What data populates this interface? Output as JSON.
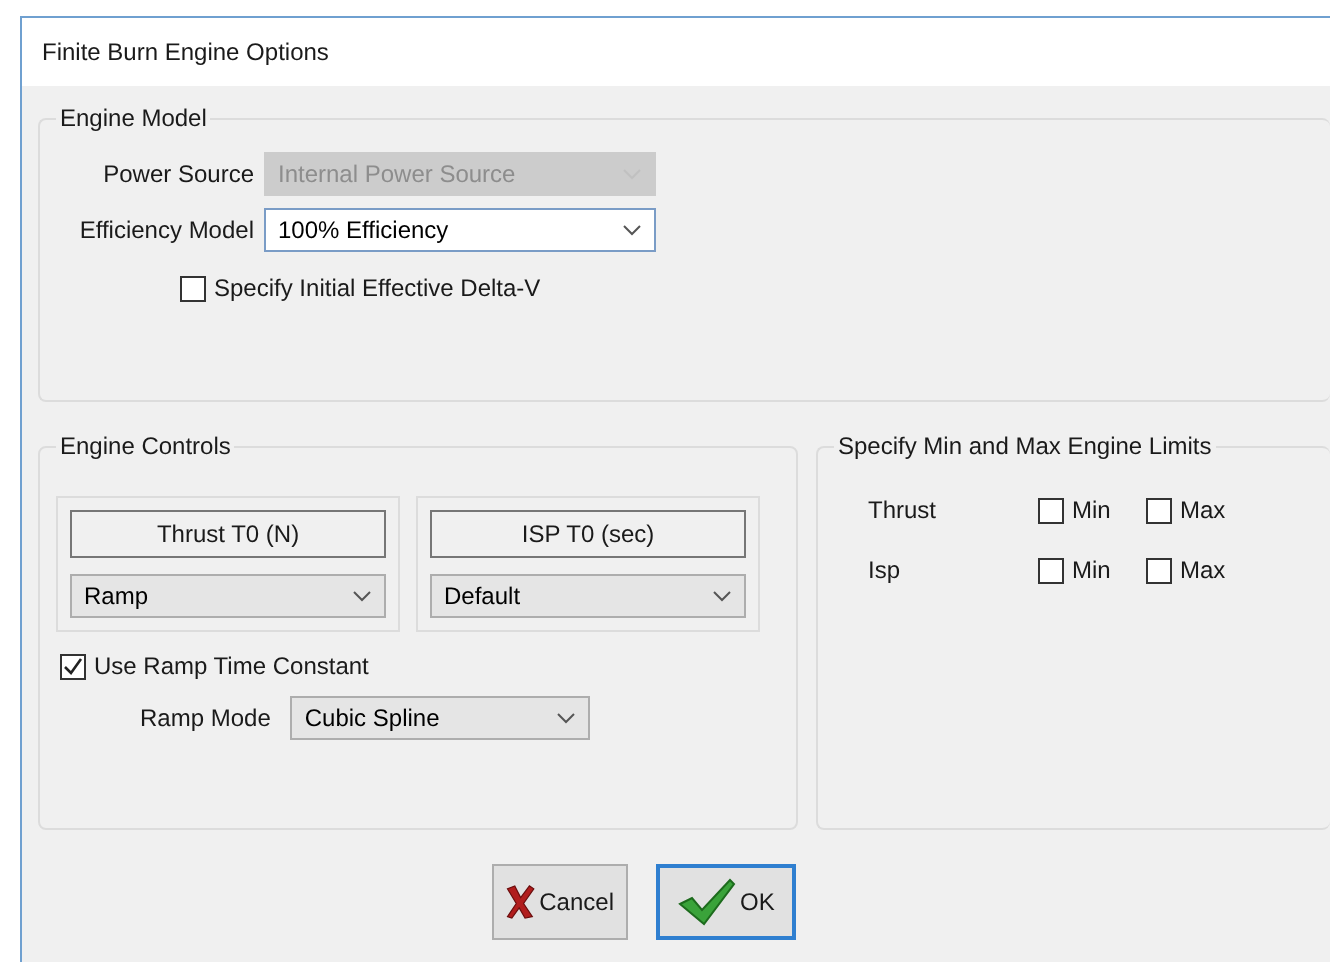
{
  "window": {
    "title": "Finite Burn Engine Options"
  },
  "engine_model": {
    "legend": "Engine Model",
    "fields": [
      {
        "label": "Power Source",
        "value": "Internal Power Source",
        "disabled": true
      },
      {
        "label": "Efficiency Model",
        "value": "100% Efficiency",
        "disabled": false
      }
    ],
    "option": {
      "label": "Specify Initial Effective Delta-V",
      "checked": false
    }
  },
  "engine_controls": {
    "legend": "Engine Controls",
    "columns": [
      {
        "header": "Thrust T0 (N)",
        "value": "Ramp"
      },
      {
        "header": "ISP T0 (sec)",
        "value": "Default"
      }
    ],
    "use_ramp": {
      "label": "Use Ramp Time Constant",
      "checked": true
    },
    "ramp_mode": {
      "label": "Ramp Mode",
      "value": "Cubic Spline"
    }
  },
  "limits": {
    "legend": "Specify Min and Max Engine Limits",
    "rows": [
      {
        "label": "Thrust",
        "min": {
          "label": "Min",
          "checked": false
        },
        "max": {
          "label": "Max",
          "checked": false
        }
      },
      {
        "label": "Isp",
        "min": {
          "label": "Min",
          "checked": false
        },
        "max": {
          "label": "Max",
          "checked": false
        }
      }
    ]
  },
  "buttons": [
    {
      "kind": "cancel",
      "label": "Cancel"
    },
    {
      "kind": "ok",
      "label": "OK"
    }
  ]
}
